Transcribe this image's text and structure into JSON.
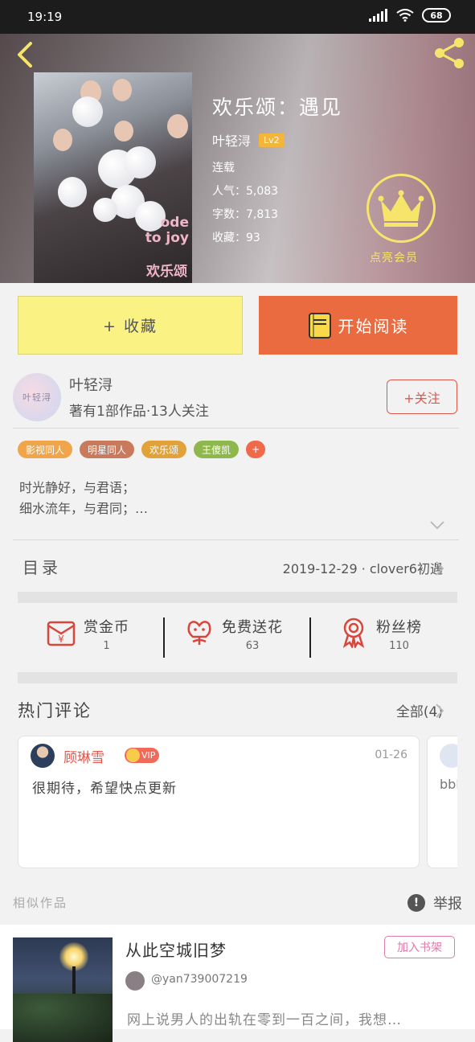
{
  "status_bar": {
    "time": "19:19",
    "battery": "68"
  },
  "book": {
    "title": "欢乐颂：遇见",
    "author": "叶轻浔",
    "level": "Lv2",
    "status": "连载",
    "popularity": "人气：5,083",
    "word_count": "字数：7,813",
    "favorites": "收藏：93",
    "cover_text_en": "ode to joy",
    "cover_text_cn": "欢乐颂"
  },
  "vip_label": "点亮会员",
  "actions": {
    "collect": "+ 收藏",
    "read": "开始阅读"
  },
  "author": {
    "avatar_text": "叶轻浔",
    "name": "叶轻浔",
    "stats": "著有1部作品·13人关注",
    "follow": "+关注"
  },
  "tags": [
    {
      "label": "影视同人",
      "color": "#f0a54a"
    },
    {
      "label": "明星同人",
      "color": "#c97a5c"
    },
    {
      "label": "欢乐颂",
      "color": "#e2a23a"
    },
    {
      "label": "王傻凯",
      "color": "#8fb84c"
    },
    {
      "label": "+",
      "color": "#ef6a4a"
    }
  ],
  "description": {
    "line1": "时光静好，与君语；",
    "line2": "细水流年，与君同；…"
  },
  "toc": {
    "label": "目录",
    "latest": "2019-12-29 · clover6初遇"
  },
  "stats": [
    {
      "label": "赏金币",
      "value": "1",
      "icon": "red-envelope-icon"
    },
    {
      "label": "免费送花",
      "value": "63",
      "icon": "flower-icon"
    },
    {
      "label": "粉丝榜",
      "value": "110",
      "icon": "award-ribbon-icon"
    }
  ],
  "comments": {
    "title": "热门评论",
    "all": "全部(4)",
    "items": [
      {
        "user": "顾琳雪",
        "badge": "VIP",
        "date": "01-26",
        "text": "很期待，希望快点更新"
      },
      {
        "user": "",
        "text": "bbb"
      }
    ]
  },
  "similar": {
    "title": "相似作品",
    "report": "举报",
    "items": [
      {
        "title": "从此空城旧梦",
        "add": "加入书架",
        "author": "@yan739007219",
        "desc": "网上说男人的出轨在零到一百之间，我想…"
      }
    ]
  },
  "colors": {
    "accent_orange": "#ea6b3f",
    "collect_yellow": "#faf383",
    "vip_gold": "#f7e46a",
    "follow_red": "#e2574c"
  }
}
